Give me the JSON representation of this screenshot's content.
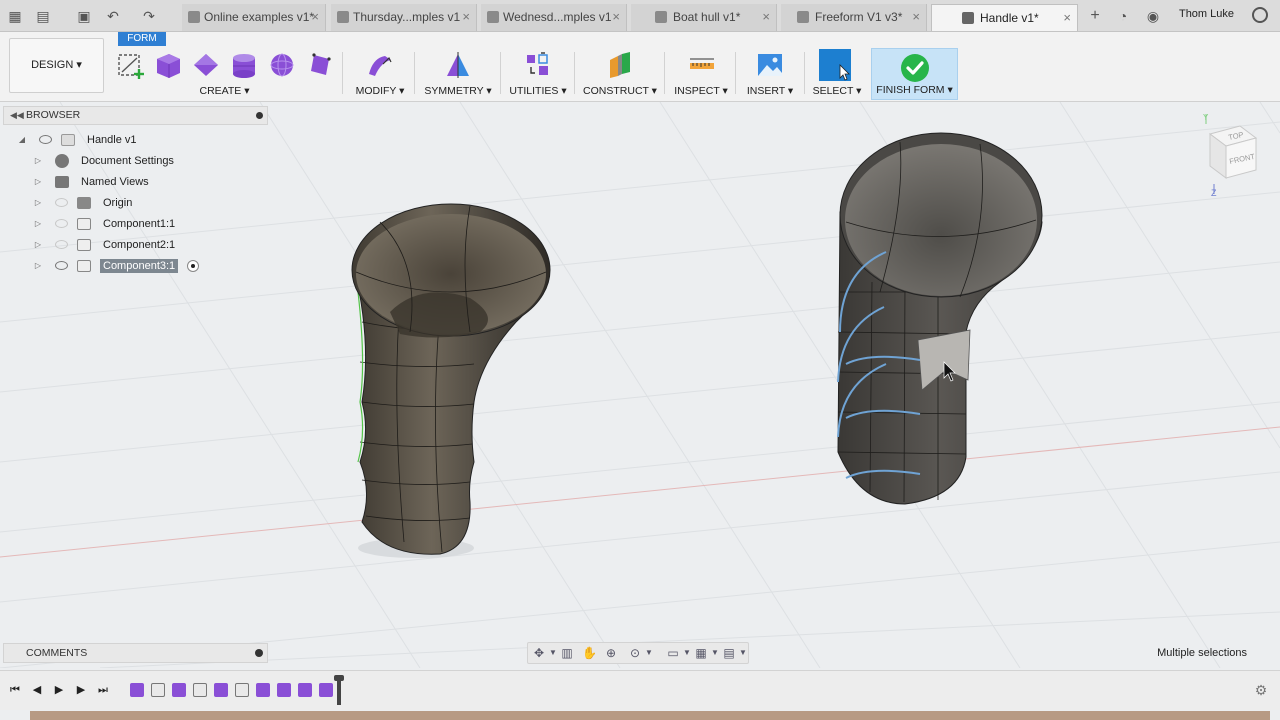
{
  "titlebar": {
    "tabs": [
      {
        "label": "Online examples v1*",
        "active": false
      },
      {
        "label": "Thursday...mples v1",
        "active": false
      },
      {
        "label": "Wednesd...mples v1",
        "active": false
      },
      {
        "label": "Boat hull v1*",
        "active": false
      },
      {
        "label": "Freeform V1 v3*",
        "active": false
      },
      {
        "label": "Handle v1*",
        "active": true
      }
    ],
    "user": "Thom Luke"
  },
  "toolbar": {
    "workspace": "DESIGN ▾",
    "active_tab": "FORM",
    "groups": {
      "create": "CREATE ▾",
      "modify": "MODIFY ▾",
      "symmetry": "SYMMETRY ▾",
      "utilities": "UTILITIES ▾",
      "construct": "CONSTRUCT ▾",
      "inspect": "INSPECT ▾",
      "insert": "INSERT ▾",
      "select": "SELECT ▾",
      "finish": "FINISH FORM ▾"
    }
  },
  "browser": {
    "title": "BROWSER",
    "root": "Handle v1",
    "items": [
      {
        "label": "Document Settings"
      },
      {
        "label": "Named Views"
      },
      {
        "label": "Origin"
      },
      {
        "label": "Component1:1"
      },
      {
        "label": "Component2:1"
      },
      {
        "label": "Component3:1"
      }
    ]
  },
  "viewcube": {
    "top": "TOP",
    "front": "FRONT",
    "axis_y": "Y",
    "axis_z": "Z"
  },
  "comments": {
    "title": "COMMENTS"
  },
  "status": {
    "text": "Multiple selections"
  },
  "colors": {
    "form_accent": "#8a4fd6",
    "finish_green": "#28b54a",
    "select_blue": "#1d7fd0",
    "panel_bg": "#f2f2f2"
  }
}
